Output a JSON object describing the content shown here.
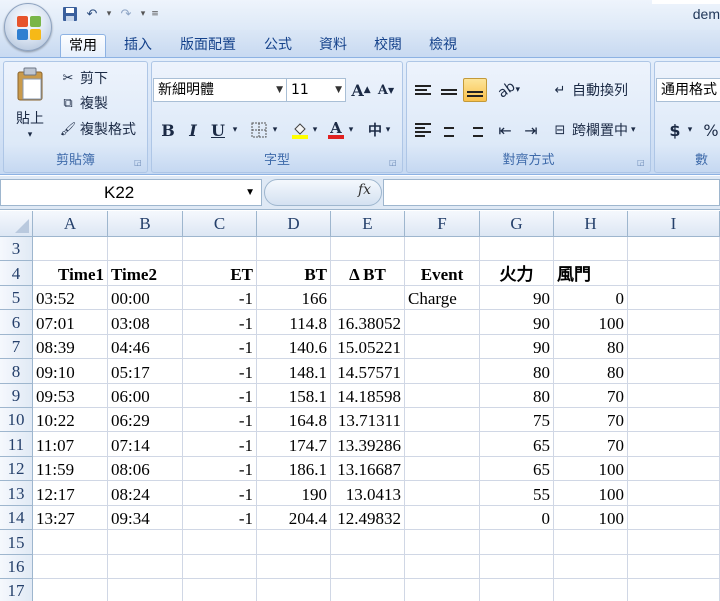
{
  "window": {
    "title": "dem"
  },
  "ribbon": {
    "tabs": [
      "常用",
      "插入",
      "版面配置",
      "公式",
      "資料",
      "校閱",
      "檢視"
    ],
    "clipboard": {
      "paste": "貼上",
      "cut": "剪下",
      "copy": "複製",
      "format_painter": "複製格式",
      "label": "剪貼簿"
    },
    "font": {
      "name": "新細明體",
      "size": "11",
      "bold": "B",
      "italic": "I",
      "underline": "U",
      "label": "字型",
      "phonetic": "中"
    },
    "alignment": {
      "wrap_text": "自動換列",
      "merge_center": "跨欄置中",
      "label": "對齊方式"
    },
    "number": {
      "format": "通用格式",
      "currency": "$",
      "percent": "%",
      "label": "數"
    }
  },
  "formula_bar": {
    "name_box": "K22",
    "fx": "fx",
    "value": ""
  },
  "sheet": {
    "columns": [
      "A",
      "B",
      "C",
      "D",
      "E",
      "F",
      "G",
      "H",
      "I"
    ],
    "rows": [
      {
        "num": "3",
        "cells": [
          "",
          "",
          "",
          "",
          "",
          "",
          "",
          "",
          ""
        ]
      },
      {
        "num": "4",
        "cells": [
          "Time1",
          "Time2",
          "ET",
          "BT",
          "Δ  BT",
          "Event",
          "火力",
          "風門",
          ""
        ]
      },
      {
        "num": "5",
        "cells": [
          "03:52",
          "00:00",
          "-1",
          "166",
          "",
          "Charge",
          "90",
          "0",
          ""
        ]
      },
      {
        "num": "6",
        "cells": [
          "07:01",
          "03:08",
          "-1",
          "114.8",
          "16.38052",
          "",
          "90",
          "100",
          ""
        ]
      },
      {
        "num": "7",
        "cells": [
          "08:39",
          "04:46",
          "-1",
          "140.6",
          "15.05221",
          "",
          "90",
          "80",
          ""
        ]
      },
      {
        "num": "8",
        "cells": [
          "09:10",
          "05:17",
          "-1",
          "148.1",
          "14.57571",
          "",
          "80",
          "80",
          ""
        ]
      },
      {
        "num": "9",
        "cells": [
          "09:53",
          "06:00",
          "-1",
          "158.1",
          "14.18598",
          "",
          "80",
          "70",
          ""
        ]
      },
      {
        "num": "10",
        "cells": [
          "10:22",
          "06:29",
          "-1",
          "164.8",
          "13.71311",
          "",
          "75",
          "70",
          ""
        ]
      },
      {
        "num": "11",
        "cells": [
          "11:07",
          "07:14",
          "-1",
          "174.7",
          "13.39286",
          "",
          "65",
          "70",
          ""
        ]
      },
      {
        "num": "12",
        "cells": [
          "11:59",
          "08:06",
          "-1",
          "186.1",
          "13.16687",
          "",
          "65",
          "100",
          ""
        ]
      },
      {
        "num": "13",
        "cells": [
          "12:17",
          "08:24",
          "-1",
          "190",
          "13.0413",
          "",
          "55",
          "100",
          ""
        ]
      },
      {
        "num": "14",
        "cells": [
          "13:27",
          "09:34",
          "-1",
          "204.4",
          "12.49832",
          "",
          "0",
          "100",
          ""
        ]
      },
      {
        "num": "15",
        "cells": [
          "",
          "",
          "",
          "",
          "",
          "",
          "",
          "",
          ""
        ]
      },
      {
        "num": "16",
        "cells": [
          "",
          "",
          "",
          "",
          "",
          "",
          "",
          "",
          ""
        ]
      },
      {
        "num": "17",
        "cells": [
          "",
          "",
          "",
          "",
          "",
          "",
          "",
          "",
          ""
        ]
      }
    ]
  }
}
